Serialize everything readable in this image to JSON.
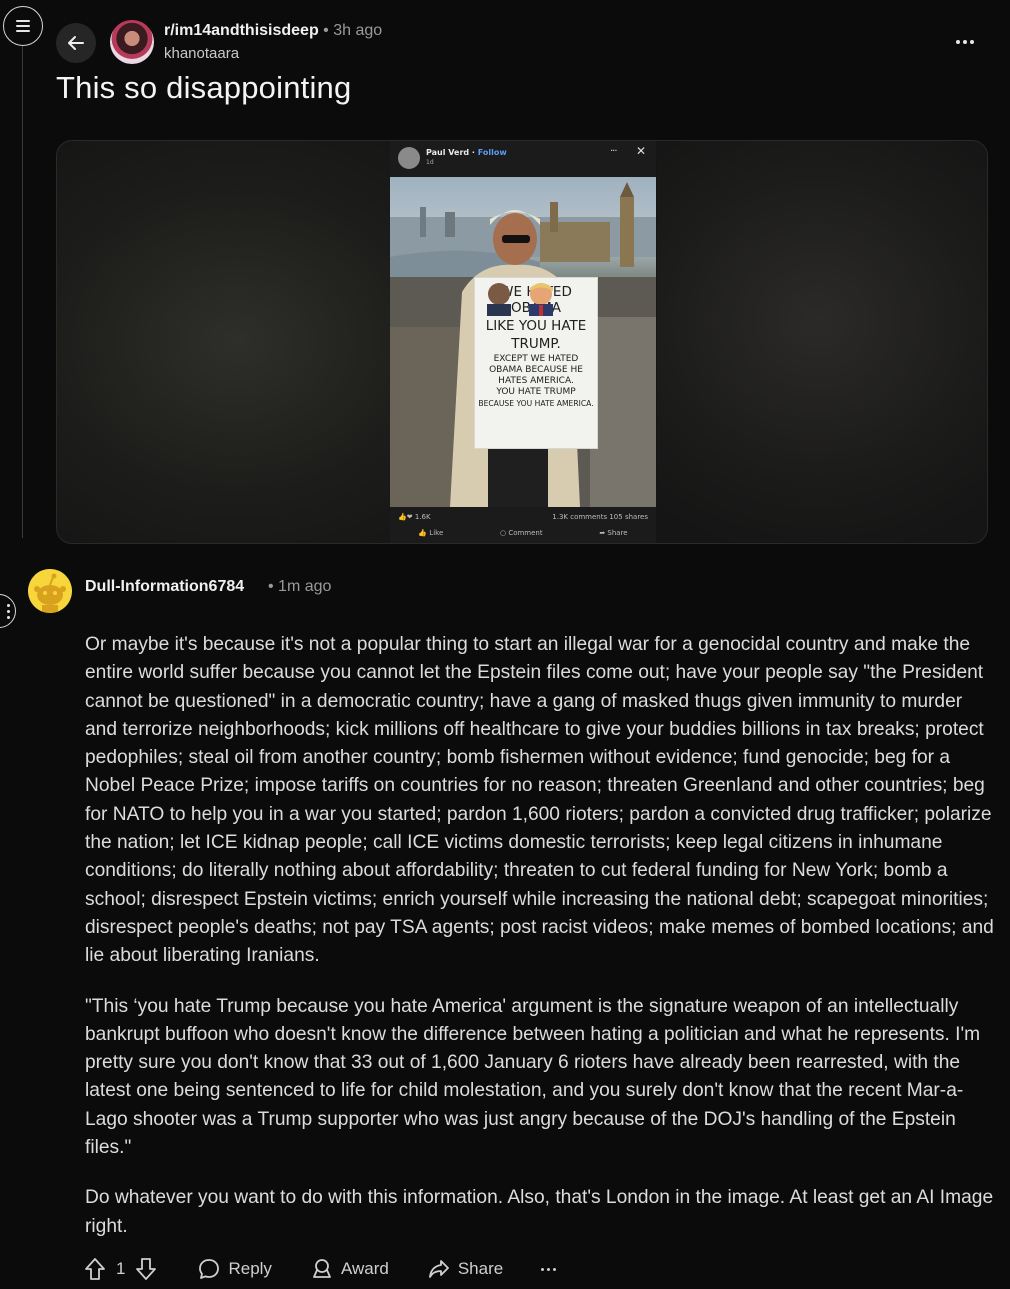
{
  "post": {
    "subreddit": "r/im14andthisisdeep",
    "time": "3h ago",
    "author": "khanotaara",
    "title": "This so disappointing"
  },
  "embedded_image": {
    "poster_name": "Paul Verd",
    "follow_label": "Follow",
    "post_date": "1d",
    "sign_line1": "WE HATED OBAMA",
    "sign_line2": "LIKE YOU HATE",
    "sign_line3": "TRUMP.",
    "sign_line4": "EXCEPT WE HATED",
    "sign_line5": "OBAMA BECAUSE HE",
    "sign_line6": "HATES AMERICA.",
    "sign_line7": "YOU HATE TRUMP",
    "sign_line8": "BECAUSE YOU HATE AMERICA.",
    "reactions": "1.6K",
    "comments_shares": "1.3K comments  105 shares",
    "like_label": "Like",
    "comment_label": "Comment",
    "share_label": "Share"
  },
  "comment": {
    "username": "Dull-Information6784",
    "time": "1m ago",
    "paragraphs": [
      "Or maybe it's because it's not a popular thing to start an illegal war for a genocidal country and make the entire world suffer because you cannot let the Epstein files come out; have your people say \"the President cannot be questioned\" in a democratic country; have a gang of masked thugs given immunity to murder and terrorize neighborhoods; kick millions off healthcare to give your buddies billions in tax breaks; protect pedophiles; steal oil from another country; bomb fishermen without evidence; fund genocide; beg for a Nobel Peace Prize; impose tariffs on countries for no reason; threaten Greenland and other countries; beg for NATO to help you in a war you started; pardon 1,600 rioters; pardon a convicted drug trafficker; polarize the nation; let ICE kidnap people; call ICE victims domestic terrorists; keep legal citizens in inhumane conditions; do literally nothing about affordability; threaten to cut federal funding for New York; bomb a school; disrespect Epstein victims; enrich yourself while increasing the national debt; scapegoat minorities; disrespect people's deaths; not pay TSA agents; post racist videos; make memes of bombed locations; and lie about liberating Iranians.",
      "\"This ‘you hate Trump because you hate America' argument is the signature weapon of an intellectually bankrupt buffoon who doesn't know the difference between hating a politician and what he represents. I'm pretty sure you don't know that 33 out of 1,600 January 6 rioters have already been rearrested, with the latest one being sentenced to life for child molestation, and you surely don't know that the recent Mar-a-Lago shooter was a Trump supporter who was just angry because of the DOJ's handling of the Epstein files.\"",
      "Do whatever you want to do with this information. Also, that's London in the image. At least get an AI Image right."
    ],
    "score": "1",
    "reply_label": "Reply",
    "award_label": "Award",
    "share_label": "Share"
  },
  "icons": {
    "menu": "hamburger-icon",
    "back": "arrow-left-icon",
    "more": "ellipsis-icon",
    "upvote": "arrow-up-icon",
    "downvote": "arrow-down-icon",
    "reply": "speech-bubble-icon",
    "award": "award-icon",
    "share": "share-arrow-icon"
  },
  "colors": {
    "background": "#0b0b0b",
    "text": "#dcdcdc",
    "muted": "#9a9a9a",
    "avatar_yellow": "#f6d63b"
  }
}
